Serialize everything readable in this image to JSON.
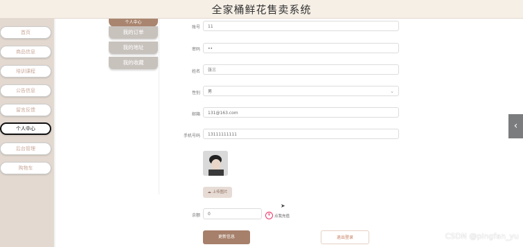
{
  "app": {
    "title": "全家桶鲜花售卖系统"
  },
  "nav": {
    "items": [
      {
        "label": "首页",
        "active": false
      },
      {
        "label": "商品信息",
        "active": false
      },
      {
        "label": "培训课程",
        "active": false
      },
      {
        "label": "公告信息",
        "active": false
      },
      {
        "label": "留言反馈",
        "active": false
      },
      {
        "label": "个人中心",
        "active": true
      },
      {
        "label": "后台管理",
        "active": false
      },
      {
        "label": "购物车",
        "active": false
      }
    ]
  },
  "sub_nav": {
    "top_label": "个人中心",
    "items": [
      "我的订单",
      "我的地址",
      "我的收藏"
    ]
  },
  "form": {
    "account": {
      "label": "账号",
      "value": "11"
    },
    "password": {
      "label": "密码",
      "value": "••"
    },
    "name": {
      "label": "姓名",
      "value": "张三"
    },
    "gender": {
      "label": "性别",
      "value": "男"
    },
    "email": {
      "label": "邮箱",
      "value": "131@163.com"
    },
    "phone": {
      "label": "手机号码",
      "value": "13111111111"
    },
    "upload_label": "上传图片",
    "balance": {
      "label": "余额",
      "value": "0"
    },
    "recharge_label": "点我充值",
    "update_label": "更新信息",
    "logout_label": "退出登录"
  },
  "icons": {
    "edge_tab": "chevron-left-icon",
    "upload": "upload-icon",
    "recharge": "recharge-icon"
  },
  "watermark": "CSDN @pingfan_yu",
  "colors": {
    "accent": "#a6806b",
    "nav_bg": "#e3d9d1",
    "header_bg": "#f6efe6"
  }
}
